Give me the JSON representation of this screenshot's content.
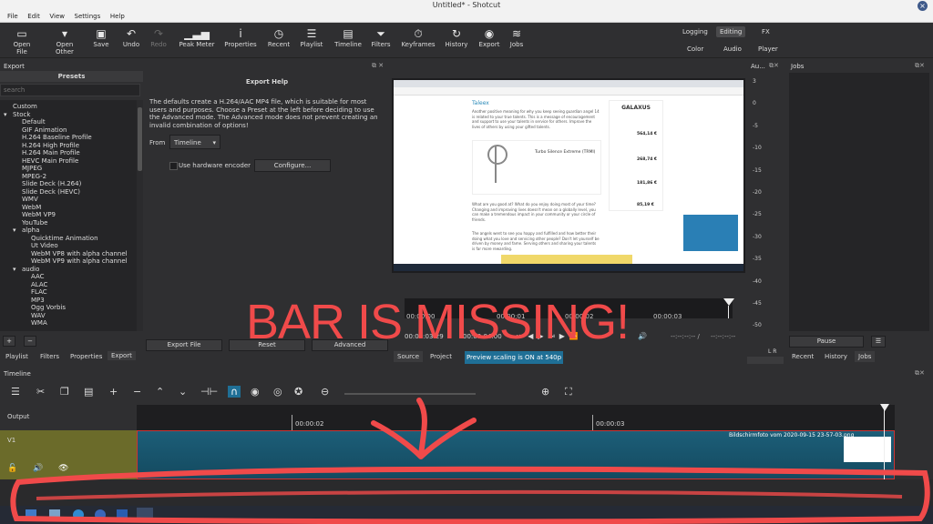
{
  "window": {
    "title": "Untitled* - Shotcut",
    "close_glyph": "×"
  },
  "menu": [
    "File",
    "Edit",
    "View",
    "Settings",
    "Help"
  ],
  "toolbar": [
    {
      "label": "Open File",
      "icon": "open-file-icon",
      "glyph": "▭"
    },
    {
      "label": "Open Other",
      "icon": "open-other-icon",
      "glyph": "▾"
    },
    {
      "label": "Save",
      "icon": "save-icon",
      "glyph": "▣"
    },
    {
      "label": "Undo",
      "icon": "undo-icon",
      "glyph": "↶"
    },
    {
      "label": "Redo",
      "icon": "redo-icon",
      "glyph": "↷"
    },
    {
      "label": "Peak Meter",
      "icon": "peak-meter-icon",
      "glyph": "▁▃▅"
    },
    {
      "label": "Properties",
      "icon": "properties-icon",
      "glyph": "i"
    },
    {
      "label": "Recent",
      "icon": "recent-icon",
      "glyph": "◷"
    },
    {
      "label": "Playlist",
      "icon": "playlist-icon",
      "glyph": "☰"
    },
    {
      "label": "Timeline",
      "icon": "timeline-icon",
      "glyph": "▤"
    },
    {
      "label": "Filters",
      "icon": "filters-icon",
      "glyph": "⏷"
    },
    {
      "label": "Keyframes",
      "icon": "keyframes-icon",
      "glyph": "⏱"
    },
    {
      "label": "History",
      "icon": "history-icon",
      "glyph": "↻"
    },
    {
      "label": "Export",
      "icon": "export-icon",
      "glyph": "◉"
    },
    {
      "label": "Jobs",
      "icon": "jobs-icon",
      "glyph": "≋"
    }
  ],
  "workspaces": {
    "top": [
      "Logging",
      "Editing",
      "FX"
    ],
    "bottom": [
      "Color",
      "Audio",
      "Player"
    ]
  },
  "export": {
    "panel_title": "Export",
    "presets_header": "Presets",
    "search_placeholder": "search",
    "help_title": "Export Help",
    "help_text": "The defaults create a H.264/AAC MP4 file, which is suitable for most users and purposes. Choose a Preset at the left before deciding to use the Advanced mode. The Advanced mode does not prevent creating an invalid combination of options!",
    "from_label": "From",
    "from_value": "Timeline",
    "hw_encoder_label": "Use hardware encoder",
    "configure_button": "Configure...",
    "presets": [
      {
        "label": "Custom",
        "indent": 1
      },
      {
        "label": "Stock",
        "indent": 1,
        "expand": "▾"
      },
      {
        "label": "Default",
        "indent": 2
      },
      {
        "label": "GIF Animation",
        "indent": 2
      },
      {
        "label": "H.264 Baseline Profile",
        "indent": 2
      },
      {
        "label": "H.264 High Profile",
        "indent": 2
      },
      {
        "label": "H.264 Main Profile",
        "indent": 2
      },
      {
        "label": "HEVC Main Profile",
        "indent": 2
      },
      {
        "label": "MJPEG",
        "indent": 2
      },
      {
        "label": "MPEG-2",
        "indent": 2
      },
      {
        "label": "Slide Deck (H.264)",
        "indent": 2
      },
      {
        "label": "Slide Deck (HEVC)",
        "indent": 2
      },
      {
        "label": "WMV",
        "indent": 2
      },
      {
        "label": "WebM",
        "indent": 2
      },
      {
        "label": "WebM VP9",
        "indent": 2
      },
      {
        "label": "YouTube",
        "indent": 2
      },
      {
        "label": "alpha",
        "indent": 2,
        "expand": "▾"
      },
      {
        "label": "Quicktime Animation",
        "indent": 3
      },
      {
        "label": "Ut Video",
        "indent": 3
      },
      {
        "label": "WebM VP8 with alpha channel",
        "indent": 3
      },
      {
        "label": "WebM VP9 with alpha channel",
        "indent": 3
      },
      {
        "label": "audio",
        "indent": 2,
        "expand": "▾"
      },
      {
        "label": "AAC",
        "indent": 3
      },
      {
        "label": "ALAC",
        "indent": 3
      },
      {
        "label": "FLAC",
        "indent": 3
      },
      {
        "label": "MP3",
        "indent": 3
      },
      {
        "label": "Ogg Vorbis",
        "indent": 3
      },
      {
        "label": "WAV",
        "indent": 3
      },
      {
        "label": "WMA",
        "indent": 3
      }
    ],
    "add_glyph": "+",
    "remove_glyph": "−",
    "buttons": {
      "export_file": "Export File",
      "reset": "Reset",
      "advanced": "Advanced"
    },
    "bottom_tabs": [
      "Playlist",
      "Filters",
      "Properties",
      "Export"
    ]
  },
  "viewer": {
    "timecode_marks": [
      "00:00:00",
      "00:00:01",
      "00:00:02",
      "00:00:03"
    ],
    "current_tc": "00:00:03:29",
    "total_tc": "00:00:04:00",
    "in_tc": "--:--:--:--  /",
    "out_tc": "--:--:--:--",
    "tabs": [
      "Source",
      "Project"
    ],
    "scaling_notice": "Preview scaling is ON at 540p",
    "webpage": {
      "brand": "GALAXUS",
      "heading": "Taleex",
      "paragraph1": "Another positive meaning for why you keep seeing guardian angel 14 is related to your true talents. This is a message of encouragement and support to use your talents in service for others. Improve the lives of others by using your gifted talents.",
      "product_title": "Turbo Silence Extreme (TRMI)",
      "paragraph2": "What are you good at? What do you enjoy doing most of your time? Changing and improving lives doesn't mean on a globally level, you can make a tremendous impact in your community or your circle of friends.",
      "paragraph3": "The angels went to see you happy and fulfilled and how better their doing what you love and servicing other people? Don't let yourself be driven by money and fame. Serving others and sharing your talents is far more rewarding.",
      "prices": [
        "564,14 €",
        "268,74 €",
        "181,86 €",
        "85,19 €"
      ]
    }
  },
  "meter": {
    "title": "Au...",
    "scale": [
      "3",
      "0",
      "-5",
      "-10",
      "-15",
      "-20",
      "-25",
      "-30",
      "-35",
      "-40",
      "-45",
      "-50"
    ],
    "lr": "L R"
  },
  "jobs": {
    "title": "Jobs",
    "pause_button": "Pause",
    "menu_glyph": "☰",
    "tabs": [
      "Recent",
      "History",
      "Jobs"
    ]
  },
  "timeline": {
    "title": "Timeline",
    "tools": [
      {
        "name": "timeline-menu-icon",
        "glyph": "☰"
      },
      {
        "name": "cut-icon",
        "glyph": "✂"
      },
      {
        "name": "copy-icon",
        "glyph": "❐"
      },
      {
        "name": "paste-icon",
        "glyph": "▤"
      },
      {
        "name": "append-icon",
        "glyph": "+"
      },
      {
        "name": "remove-icon",
        "glyph": "−"
      },
      {
        "name": "lift-icon",
        "glyph": "⌃"
      },
      {
        "name": "overwrite-icon",
        "glyph": "⌄"
      },
      {
        "name": "split-icon",
        "glyph": "⊣⊢"
      },
      {
        "name": "snap-icon",
        "glyph": "∩"
      },
      {
        "name": "scrub-icon",
        "glyph": "◉"
      },
      {
        "name": "ripple-icon",
        "glyph": "◎"
      },
      {
        "name": "ripple-all-icon",
        "glyph": "✪"
      },
      {
        "name": "zoom-out-icon",
        "glyph": "⊖"
      },
      {
        "name": "zoom-in-icon",
        "glyph": "⊕"
      },
      {
        "name": "zoom-fit-icon",
        "glyph": "⛶"
      }
    ],
    "output_label": "Output",
    "track_label": "V1",
    "ruler_marks": [
      "00:00:02",
      "00:00:03"
    ],
    "clip_name": "Bildschirmfoto vom 2020-09-15 23-57-03.png",
    "track_icons": [
      {
        "name": "lock-icon",
        "glyph": "🔓"
      },
      {
        "name": "mute-icon",
        "glyph": "🔊"
      },
      {
        "name": "hide-icon",
        "glyph": "👁"
      }
    ]
  },
  "annotation": {
    "text": "BAR IS MISSING!",
    "color": "#f04a4a"
  },
  "colors": {
    "accent_blue": "#1f6f96",
    "clip_teal": "#1c5e78",
    "track_olive": "#6b6b2a",
    "annotation_red": "#f04a4a"
  }
}
